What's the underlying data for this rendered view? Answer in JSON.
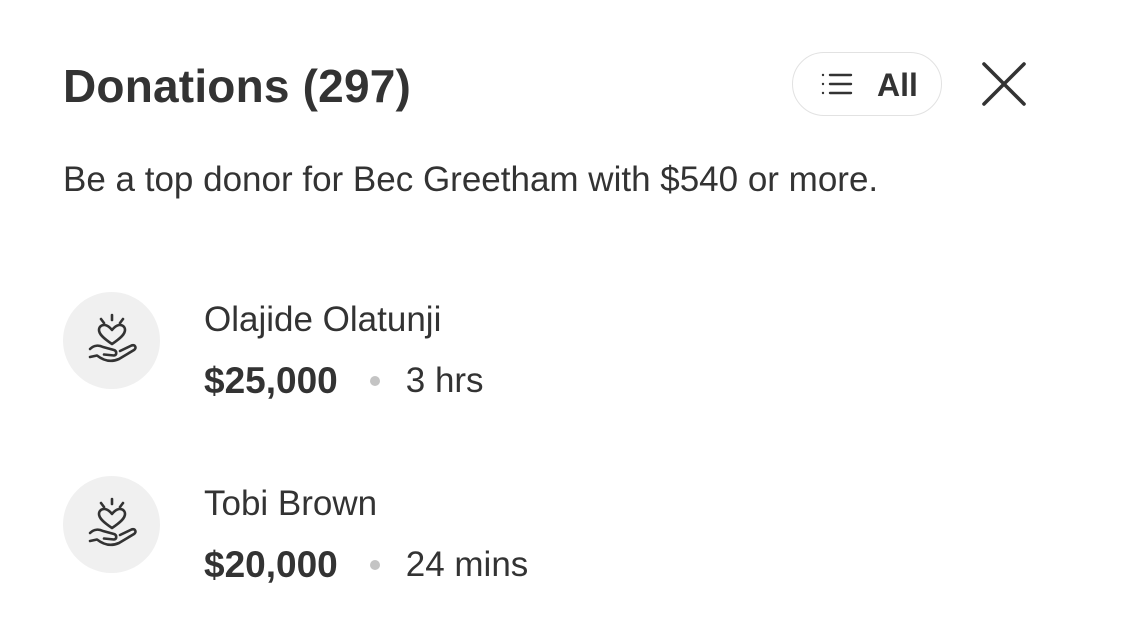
{
  "header": {
    "title": "Donations (297)",
    "filter_label": "All",
    "filter_icon": "list-icon",
    "close_icon": "close-icon"
  },
  "subtitle": "Be a top donor for Bec Greetham with $540 or more.",
  "donations": [
    {
      "name": "Olajide Olatunji",
      "amount": "$25,000",
      "time": "3 hrs",
      "icon": "heart-hand-icon"
    },
    {
      "name": "Tobi Brown",
      "amount": "$20,000",
      "time": "24 mins",
      "icon": "heart-hand-icon"
    }
  ],
  "colors": {
    "text": "#333333",
    "avatar_bg": "#f0f0f0",
    "dot": "#c4c4c4",
    "border": "#e2e2e2"
  }
}
